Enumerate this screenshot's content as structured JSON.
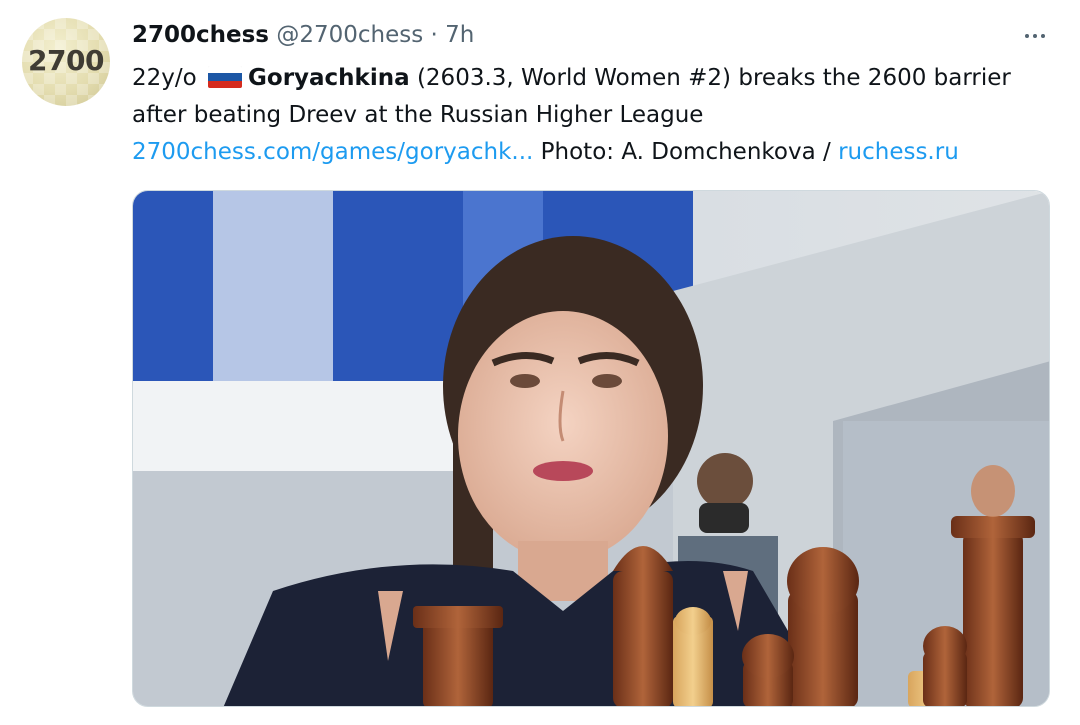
{
  "tweet": {
    "avatar_text": "2700",
    "display_name": "2700chess",
    "handle": "@2700chess",
    "separator": "·",
    "time": "7h",
    "more_icon": "more-horizontal-icon",
    "text": {
      "line1_prefix": "22y/o",
      "flag_icon": "russia-flag-icon",
      "flag_colors": [
        "#ffffff",
        "#1c57a5",
        "#d52b1e"
      ],
      "line1_bold": "Goryachkina",
      "line1_rest": " (2603.3, World Women #2) breaks the 2600 barrier",
      "line2": "after beating Dreev at the Russian Higher League",
      "link1": "2700chess.com/games/goryachk...",
      "photo_credit": " Photo: A. Domchenkova / ",
      "link2": "ruchess.ru"
    },
    "media": {
      "alt": "photo"
    }
  },
  "colors": {
    "text": "#0f1419",
    "secondary": "#536471",
    "link": "#1d9bf0",
    "border": "#cfd9de"
  }
}
